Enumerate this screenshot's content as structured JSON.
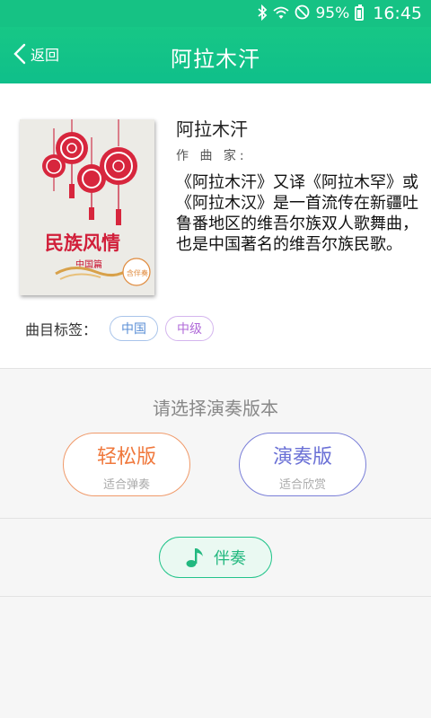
{
  "status_bar": {
    "battery": "95%",
    "time": "16:45",
    "icons": [
      "bluetooth-icon",
      "wifi-icon",
      "do-not-disturb-icon",
      "battery-icon"
    ]
  },
  "nav": {
    "back_label": "返回",
    "title": "阿拉木汗"
  },
  "song": {
    "title": "阿拉木汗",
    "composer_label": "作 曲 家:",
    "description": "《阿拉木汗》又译《阿拉木罕》或《阿拉木汉》是一首流传在新疆吐鲁番地区的维吾尔族双人歌舞曲，也是中国著名的维吾尔族民歌。",
    "cover": {
      "title": "民族风情",
      "subtitle": "中国篇",
      "badge": "含伴奏"
    }
  },
  "tags": {
    "label": "曲目标签：",
    "items": [
      "中国",
      "中级"
    ]
  },
  "versions": {
    "title": "请选择演奏版本",
    "easy": {
      "label": "轻松版",
      "sub": "适合弹奏"
    },
    "performance": {
      "label": "演奏版",
      "sub": "适合欣赏"
    }
  },
  "accompaniment": {
    "label": "伴奏",
    "icon": "music-note-icon"
  },
  "colors": {
    "primary_green": "#16c284",
    "easy_orange": "#f0783c",
    "perf_purple": "#6a70d6",
    "tag_blue": "#5b8fd6",
    "tag_purple": "#b06ad9"
  }
}
